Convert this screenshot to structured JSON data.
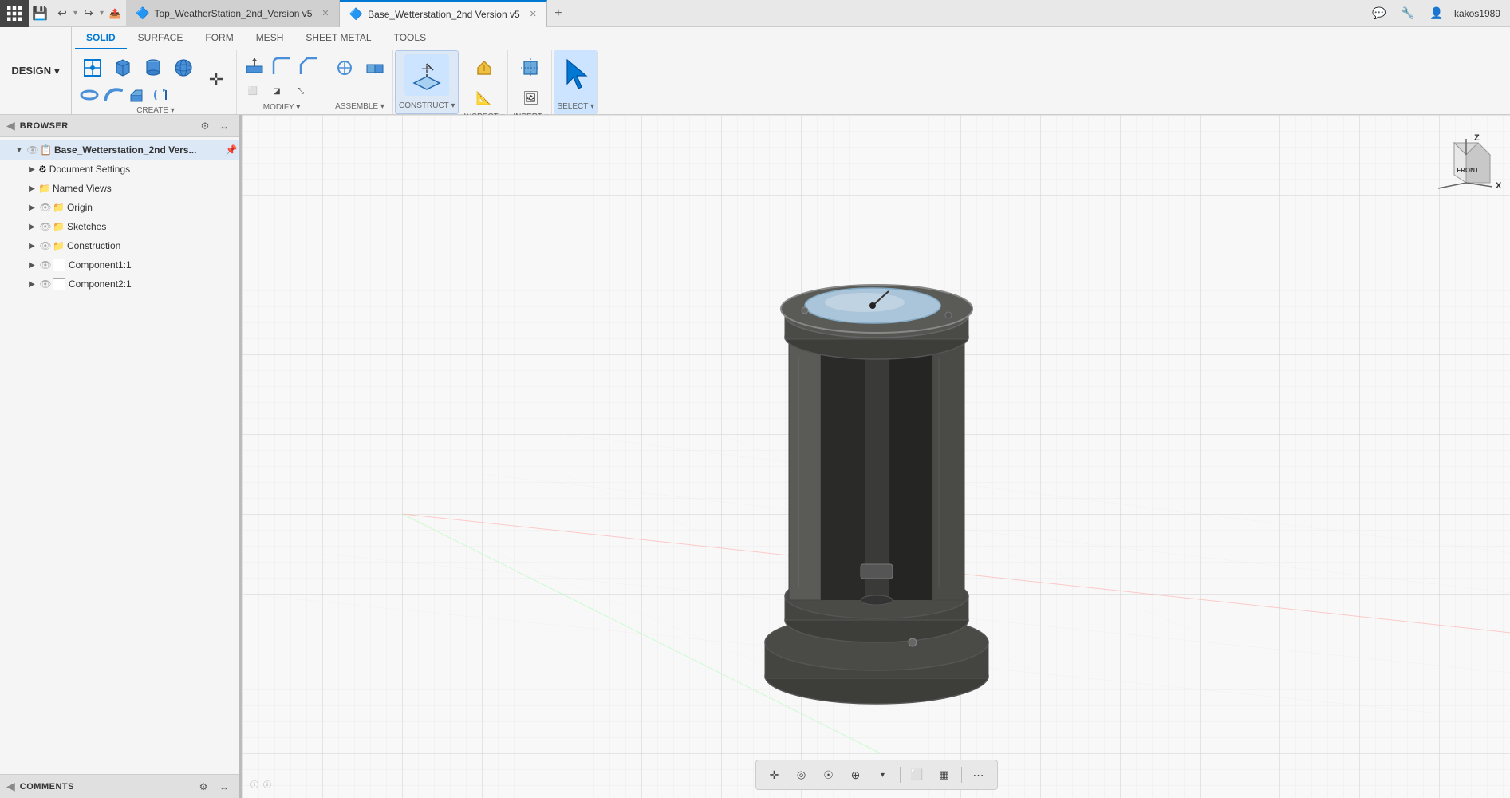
{
  "titlebar": {
    "tabs": [
      {
        "id": "tab1",
        "label": "Top_WeatherStation_2nd_Version v5",
        "active": false,
        "icon": "📄"
      },
      {
        "id": "tab2",
        "label": "Base_Wetterstation_2nd Version v5",
        "active": true,
        "icon": "📄"
      }
    ],
    "user": "kakos1989",
    "new_tab_label": "+"
  },
  "toolbar": {
    "design_label": "DESIGN",
    "design_arrow": "▾",
    "tabs": [
      {
        "id": "solid",
        "label": "SOLID",
        "active": true
      },
      {
        "id": "surface",
        "label": "SURFACE",
        "active": false
      },
      {
        "id": "form",
        "label": "FORM",
        "active": false
      },
      {
        "id": "mesh",
        "label": "MESH",
        "active": false
      },
      {
        "id": "sheet_metal",
        "label": "SHEET METAL",
        "active": false
      },
      {
        "id": "tools",
        "label": "TOOLS",
        "active": false
      }
    ],
    "groups": {
      "create_label": "CREATE ▾",
      "modify_label": "MODIFY ▾",
      "assemble_label": "ASSEMBLE ▾",
      "construct_label": "CONSTRUCT ▾",
      "inspect_label": "INSPECT ▾",
      "insert_label": "INSERT ▾",
      "select_label": "SELECT ▾"
    }
  },
  "sidebar": {
    "header_label": "BROWSER",
    "tree": [
      {
        "id": "root",
        "label": "Base_Wetterstation_2nd Vers...",
        "level": 0,
        "expanded": true,
        "type": "root",
        "icon": "📋",
        "has_eye": false,
        "has_checkbox": false,
        "pinned": true
      },
      {
        "id": "doc_settings",
        "label": "Document Settings",
        "level": 1,
        "expanded": false,
        "type": "folder",
        "icon": "⚙️",
        "has_eye": false,
        "has_checkbox": false
      },
      {
        "id": "named_views",
        "label": "Named Views",
        "level": 1,
        "expanded": false,
        "type": "folder",
        "icon": "📁",
        "has_eye": false,
        "has_checkbox": false
      },
      {
        "id": "origin",
        "label": "Origin",
        "level": 1,
        "expanded": false,
        "type": "folder",
        "icon": "📁",
        "has_eye": true,
        "has_checkbox": false
      },
      {
        "id": "sketches",
        "label": "Sketches",
        "level": 1,
        "expanded": false,
        "type": "folder",
        "icon": "📁",
        "has_eye": true,
        "has_checkbox": false
      },
      {
        "id": "construction",
        "label": "Construction",
        "level": 1,
        "expanded": false,
        "type": "folder",
        "icon": "📁",
        "has_eye": true,
        "has_checkbox": false
      },
      {
        "id": "component1",
        "label": "Component1:1",
        "level": 1,
        "expanded": false,
        "type": "component",
        "icon": "⬜",
        "has_eye": true,
        "has_checkbox": true
      },
      {
        "id": "component2",
        "label": "Component2:1",
        "level": 1,
        "expanded": false,
        "type": "component",
        "icon": "⬜",
        "has_eye": true,
        "has_checkbox": true
      }
    ]
  },
  "comments": {
    "label": "COMMENTS"
  },
  "viewport": {
    "background_color": "#f0f0f0"
  },
  "viewcube": {
    "face": "FRONT",
    "z_label": "Z",
    "x_label": "X"
  },
  "bottom_toolbar": {
    "buttons": [
      {
        "id": "move",
        "icon": "✛",
        "tooltip": "Move/Pan"
      },
      {
        "id": "look",
        "icon": "📷",
        "tooltip": "Look At"
      },
      {
        "id": "orbit",
        "icon": "✋",
        "tooltip": "Orbit"
      },
      {
        "id": "zoom",
        "icon": "🔍",
        "tooltip": "Zoom"
      },
      {
        "id": "display",
        "icon": "🖼",
        "tooltip": "Display Settings"
      },
      {
        "id": "sep1",
        "type": "sep"
      },
      {
        "id": "grid",
        "icon": "⊞",
        "tooltip": "Grid"
      },
      {
        "id": "table",
        "icon": "▦",
        "tooltip": "Table"
      },
      {
        "id": "sep2",
        "type": "sep"
      },
      {
        "id": "more",
        "icon": "⋯",
        "tooltip": "More"
      }
    ]
  }
}
